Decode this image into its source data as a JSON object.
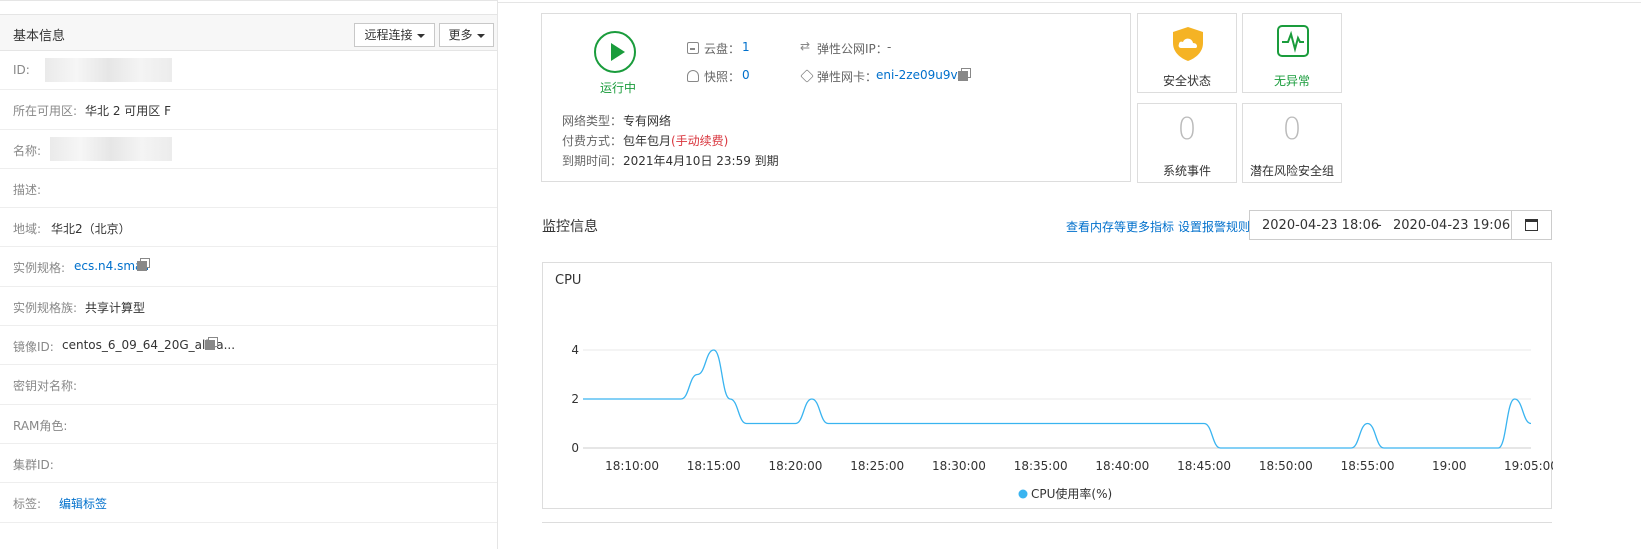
{
  "basic": {
    "title": "基本信息",
    "remote_label": "远程连接",
    "more_label": "更多",
    "rows": [
      {
        "label": "ID:",
        "value": ""
      },
      {
        "label": "所在可用区:",
        "value": "华北 2 可用区 F"
      },
      {
        "label": "名称:",
        "value": ""
      },
      {
        "label": "描述:",
        "value": ""
      },
      {
        "label": "地域:",
        "value": "华北2（北京）"
      },
      {
        "label": "实例规格:",
        "value": "ecs.n4.small"
      },
      {
        "label": "实例规格族:",
        "value": "共享计算型"
      },
      {
        "label": "镜像ID:",
        "value": "centos_6_09_64_20G_aliba..."
      },
      {
        "label": "密钥对名称:",
        "value": ""
      },
      {
        "label": "RAM角色:",
        "value": ""
      },
      {
        "label": "集群ID:",
        "value": ""
      },
      {
        "label": "标签:",
        "value": "编辑标签"
      }
    ]
  },
  "status": {
    "state": "运行中",
    "disk_label": "云盘：",
    "disk_value": "1",
    "snap_label": "快照：",
    "snap_value": "0",
    "eip_label": "弹性公网IP：",
    "eip_value": "-",
    "eni_label": "弹性网卡：",
    "eni_value": "eni-2ze09u9v...",
    "net_label": "网络类型：",
    "net_value": "专有网络",
    "pay_label": "付费方式：",
    "pay_value": "包年包月",
    "pay_note": "(手动续费)",
    "expire_label": "到期时间：",
    "expire_value": "2021年4月10日 23:59 到期"
  },
  "cards": {
    "security": "安全状态",
    "normal": "无异常",
    "events_num": "0",
    "events": "系统事件",
    "risk_num": "0",
    "risk": "潜在风险安全组"
  },
  "monitor": {
    "title": "监控信息",
    "link_more": "查看内存等更多指标",
    "link_alarm": "设置报警规则",
    "date_from": "2020-04-23 18:06",
    "date_sep": "-",
    "date_to": "2020-04-23 19:06"
  },
  "colors": {
    "accent": "#0070cc",
    "running": "#1a9c3c",
    "shield": "#f5b324",
    "line": "#3ab4f0",
    "warn": "#d9363e"
  },
  "chart_data": {
    "type": "line",
    "title": "CPU",
    "x": [
      "18:07",
      "18:08",
      "18:09",
      "18:10",
      "18:11",
      "18:12",
      "18:13",
      "18:14",
      "18:15",
      "18:16",
      "18:17",
      "18:18",
      "18:19",
      "18:20",
      "18:21",
      "18:22",
      "18:23",
      "18:24",
      "18:25",
      "18:26",
      "18:27",
      "18:28",
      "18:29",
      "18:30",
      "18:31",
      "18:32",
      "18:33",
      "18:34",
      "18:35",
      "18:36",
      "18:37",
      "18:38",
      "18:39",
      "18:40",
      "18:41",
      "18:42",
      "18:43",
      "18:44",
      "18:45",
      "18:46",
      "18:47",
      "18:48",
      "18:49",
      "18:50",
      "18:51",
      "18:52",
      "18:53",
      "18:54",
      "18:55",
      "18:56",
      "18:57",
      "18:58",
      "18:59",
      "19:00",
      "19:01",
      "19:02",
      "19:03",
      "19:04",
      "19:05"
    ],
    "series": [
      {
        "name": "CPU使用率(%)",
        "values": [
          2,
          2,
          2,
          2,
          2,
          2,
          2,
          3,
          4,
          2,
          1,
          1,
          1,
          1,
          2,
          1,
          1,
          1,
          1,
          1,
          1,
          1,
          1,
          1,
          1,
          1,
          1,
          1,
          1,
          1,
          1,
          1,
          1,
          1,
          1,
          1,
          1,
          1,
          1,
          0,
          0,
          0,
          0,
          0,
          0,
          0,
          0,
          0,
          1,
          0,
          0,
          0,
          0,
          0,
          0,
          0,
          0,
          2,
          1
        ]
      }
    ],
    "xticks": [
      "18:10:00",
      "18:15:00",
      "18:20:00",
      "18:25:00",
      "18:30:00",
      "18:35:00",
      "18:40:00",
      "18:45:00",
      "18:50:00",
      "18:55:00",
      "19:00",
      "19:05:00"
    ],
    "yticks": [
      "0",
      "2",
      "4"
    ],
    "ylim": [
      0,
      4
    ],
    "legend": "bottom-center",
    "grid": true
  }
}
